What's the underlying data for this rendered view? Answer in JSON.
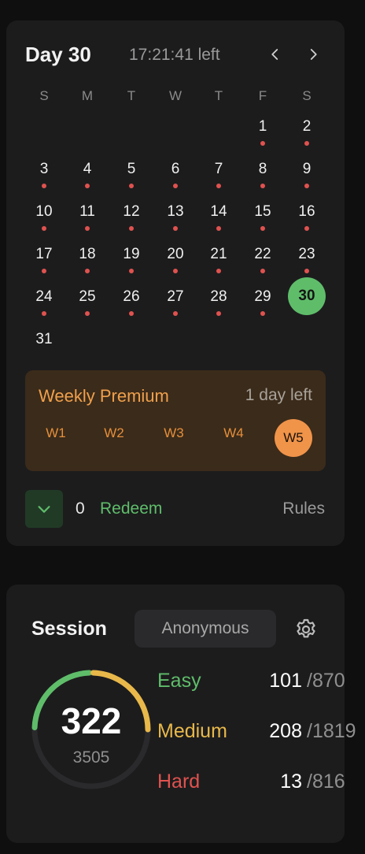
{
  "calendar": {
    "title": "Day 30",
    "time_left": "17:21:41 left",
    "weekdays": [
      "S",
      "M",
      "T",
      "W",
      "T",
      "F",
      "S"
    ],
    "days": [
      {
        "n": "1",
        "dot": true
      },
      {
        "n": "2",
        "dot": true
      },
      {
        "n": "3",
        "dot": true
      },
      {
        "n": "4",
        "dot": true
      },
      {
        "n": "5",
        "dot": true
      },
      {
        "n": "6",
        "dot": true
      },
      {
        "n": "7",
        "dot": true
      },
      {
        "n": "8",
        "dot": true
      },
      {
        "n": "9",
        "dot": true
      },
      {
        "n": "10",
        "dot": true
      },
      {
        "n": "11",
        "dot": true
      },
      {
        "n": "12",
        "dot": true
      },
      {
        "n": "13",
        "dot": true
      },
      {
        "n": "14",
        "dot": true
      },
      {
        "n": "15",
        "dot": true
      },
      {
        "n": "16",
        "dot": true
      },
      {
        "n": "17",
        "dot": true
      },
      {
        "n": "18",
        "dot": true
      },
      {
        "n": "19",
        "dot": true
      },
      {
        "n": "20",
        "dot": true
      },
      {
        "n": "21",
        "dot": true
      },
      {
        "n": "22",
        "dot": true
      },
      {
        "n": "23",
        "dot": true
      },
      {
        "n": "24",
        "dot": true
      },
      {
        "n": "25",
        "dot": true
      },
      {
        "n": "26",
        "dot": true
      },
      {
        "n": "27",
        "dot": true
      },
      {
        "n": "28",
        "dot": true
      },
      {
        "n": "29",
        "dot": true
      },
      {
        "n": "30",
        "dot": false,
        "today": true
      },
      {
        "n": "31",
        "dot": false
      }
    ],
    "first_weekday": 5
  },
  "weekly": {
    "title": "Weekly Premium",
    "time_left": "1 day left",
    "weeks": [
      "W1",
      "W2",
      "W3",
      "W4",
      "W5"
    ],
    "active_week": "W5"
  },
  "footer": {
    "points": "0",
    "redeem_label": "Redeem",
    "rules_label": "Rules"
  },
  "session": {
    "title": "Session",
    "selector": "Anonymous",
    "solved": "322",
    "total": "3505",
    "stats": [
      {
        "label": "Easy",
        "solved": "101",
        "total": "/870",
        "color": "#5fbd6a"
      },
      {
        "label": "Medium",
        "solved": "208",
        "total": "/1819",
        "color": "#e8b84a"
      },
      {
        "label": "Hard",
        "solved": "13",
        "total": "/816",
        "color": "#e0524f"
      }
    ]
  },
  "colors": {
    "easy": "#5fbd6a",
    "medium": "#e8b84a",
    "hard": "#e0524f",
    "accent_orange": "#f0944a"
  },
  "icons": {
    "prev": "chevron-left-icon",
    "next": "chevron-right-icon",
    "toggle": "chevron-down-icon",
    "settings": "gear-icon"
  }
}
